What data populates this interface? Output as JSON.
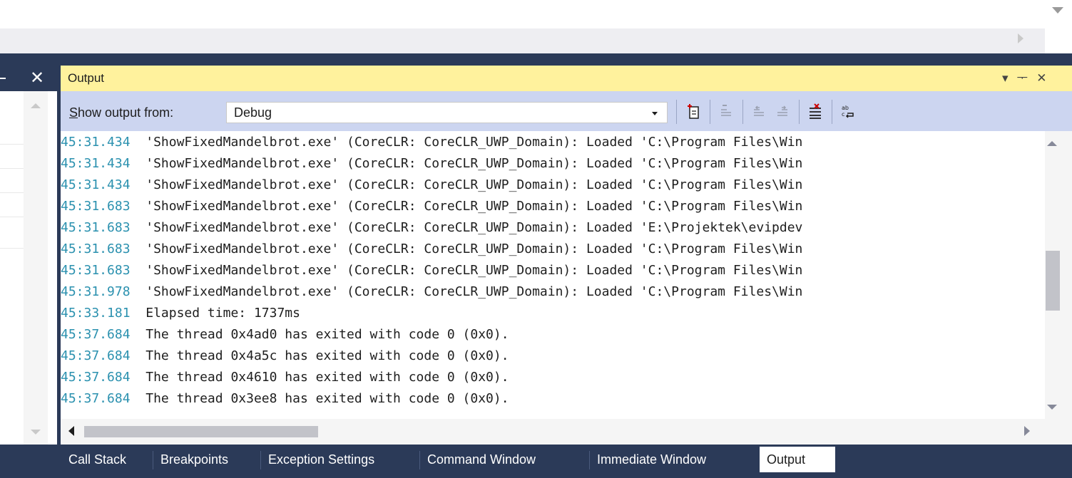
{
  "output_panel": {
    "title": "Output",
    "title_icons": [
      "▾",
      "ᅮ",
      "✕"
    ]
  },
  "left_panel": {
    "close_icon": "✕"
  },
  "toolbar": {
    "show_output_label_accel": "S",
    "show_output_label_rest": "how output from:",
    "source_selected": "Debug"
  },
  "log": [
    {
      "time": "45:31.434",
      "text": "'ShowFixedMandelbrot.exe' (CoreCLR: CoreCLR_UWP_Domain): Loaded 'C:\\Program Files\\Win"
    },
    {
      "time": "45:31.434",
      "text": "'ShowFixedMandelbrot.exe' (CoreCLR: CoreCLR_UWP_Domain): Loaded 'C:\\Program Files\\Win"
    },
    {
      "time": "45:31.434",
      "text": "'ShowFixedMandelbrot.exe' (CoreCLR: CoreCLR_UWP_Domain): Loaded 'C:\\Program Files\\Win"
    },
    {
      "time": "45:31.683",
      "text": "'ShowFixedMandelbrot.exe' (CoreCLR: CoreCLR_UWP_Domain): Loaded 'C:\\Program Files\\Win"
    },
    {
      "time": "45:31.683",
      "text": "'ShowFixedMandelbrot.exe' (CoreCLR: CoreCLR_UWP_Domain): Loaded 'E:\\Projektek\\evipdev"
    },
    {
      "time": "45:31.683",
      "text": "'ShowFixedMandelbrot.exe' (CoreCLR: CoreCLR_UWP_Domain): Loaded 'C:\\Program Files\\Win"
    },
    {
      "time": "45:31.683",
      "text": "'ShowFixedMandelbrot.exe' (CoreCLR: CoreCLR_UWP_Domain): Loaded 'C:\\Program Files\\Win"
    },
    {
      "time": "45:31.978",
      "text": "'ShowFixedMandelbrot.exe' (CoreCLR: CoreCLR_UWP_Domain): Loaded 'C:\\Program Files\\Win"
    },
    {
      "time": "45:33.181",
      "text": "Elapsed time: 1737ms"
    },
    {
      "time": "45:37.684",
      "text": "The thread 0x4ad0 has exited with code 0 (0x0)."
    },
    {
      "time": "45:37.684",
      "text": "The thread 0x4a5c has exited with code 0 (0x0)."
    },
    {
      "time": "45:37.684",
      "text": "The thread 0x4610 has exited with code 0 (0x0)."
    },
    {
      "time": "45:37.684",
      "text": "The thread 0x3ee8 has exited with code 0 (0x0)."
    }
  ],
  "tabs": [
    {
      "label": "Call Stack",
      "active": false
    },
    {
      "label": "Breakpoints",
      "active": false
    },
    {
      "label": "Exception Settings",
      "active": false
    },
    {
      "label": "Command Window",
      "active": false
    },
    {
      "label": "Immediate Window",
      "active": false
    },
    {
      "label": "Output",
      "active": true
    }
  ],
  "colors": {
    "timestamp": "#2b91af",
    "title_bar": "#fff29d",
    "toolbar": "#ccd5f0",
    "frame": "#2b3a58"
  }
}
